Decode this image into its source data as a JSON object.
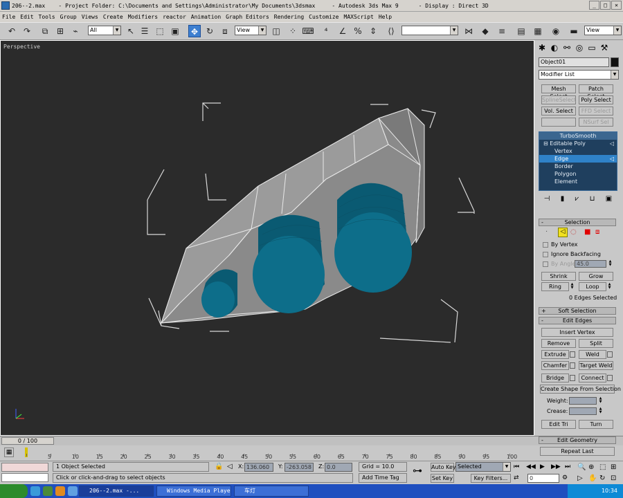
{
  "window": {
    "title": "206--2.max    - Project Folder: C:\\Documents and Settings\\Administrator\\My Documents\\3dsmax     - Autodesk 3ds Max 9      - Display : Direct 3D",
    "min": "_",
    "max": "□",
    "close": "✕"
  },
  "menu": [
    "File",
    "Edit",
    "Tools",
    "Group",
    "Views",
    "Create",
    "Modifiers",
    "reactor",
    "Animation",
    "Graph Editors",
    "Rendering",
    "Customize",
    "MAXScript",
    "Help"
  ],
  "toolbar": {
    "selection_filter": "All",
    "ref_coord": "View",
    "named_sel": "",
    "render_view": "View"
  },
  "viewport": {
    "label": "Perspective"
  },
  "command_panel": {
    "object_name": "Object01",
    "modifier_list": "Modifier List",
    "mod_buttons": [
      "Mesh Select",
      "Patch Select",
      "SplineSelect",
      "Poly Select",
      "Vol. Select",
      "FFD Select",
      "",
      "NSurf Sel"
    ],
    "stack": {
      "top": "TurboSmooth",
      "base": "Editable Poly",
      "subs": [
        "Vertex",
        "Edge",
        "Border",
        "Polygon",
        "Element"
      ]
    },
    "selection": {
      "title": "Selection",
      "by_vertex": "By Vertex",
      "ignore_backfacing": "Ignore Backfacing",
      "by_angle": "By Angle:",
      "angle_value": "45.0",
      "shrink": "Shrink",
      "grow": "Grow",
      "ring": "Ring",
      "loop": "Loop",
      "status": "0 Edges Selected"
    },
    "soft_selection": "Soft Selection",
    "edit_edges": {
      "title": "Edit Edges",
      "insert_vertex": "Insert Vertex",
      "remove": "Remove",
      "split": "Split",
      "extrude": "Extrude",
      "weld": "Weld",
      "chamfer": "Chamfer",
      "target_weld": "Target Weld",
      "bridge": "Bridge",
      "connect": "Connect",
      "create_shape": "Create Shape From Selection",
      "weight": "Weight:",
      "crease": "Crease:",
      "edit_tri": "Edit Tri",
      "turn": "Turn"
    },
    "edit_geometry": "Edit Geometry",
    "repeat_last": "Repeat Last"
  },
  "time": {
    "slider": "0 / 100",
    "ticks": [
      "0",
      "5",
      "10",
      "15",
      "20",
      "25",
      "30",
      "35",
      "40",
      "45",
      "50",
      "55",
      "60",
      "65",
      "70",
      "75",
      "80",
      "85",
      "90",
      "95",
      "100"
    ]
  },
  "status": {
    "selected": "1 Object Selected",
    "prompt": "Click or click-and-drag to select objects",
    "x_label": "X:",
    "x": "136.060",
    "y_label": "Y:",
    "y": "-263.058",
    "z_label": "Z:",
    "z": "0.0",
    "grid": "Grid = 10.0",
    "add_time_tag": "Add Time Tag",
    "auto_key": "Auto Key",
    "set_key": "Set Key",
    "key_mode": "Selected",
    "key_filters": "Key Filters...",
    "frame": "0"
  },
  "taskbar": {
    "tasks": [
      "206--2.max    -...",
      "Windows Media Player",
      "车灯"
    ],
    "clock": "10:34"
  }
}
